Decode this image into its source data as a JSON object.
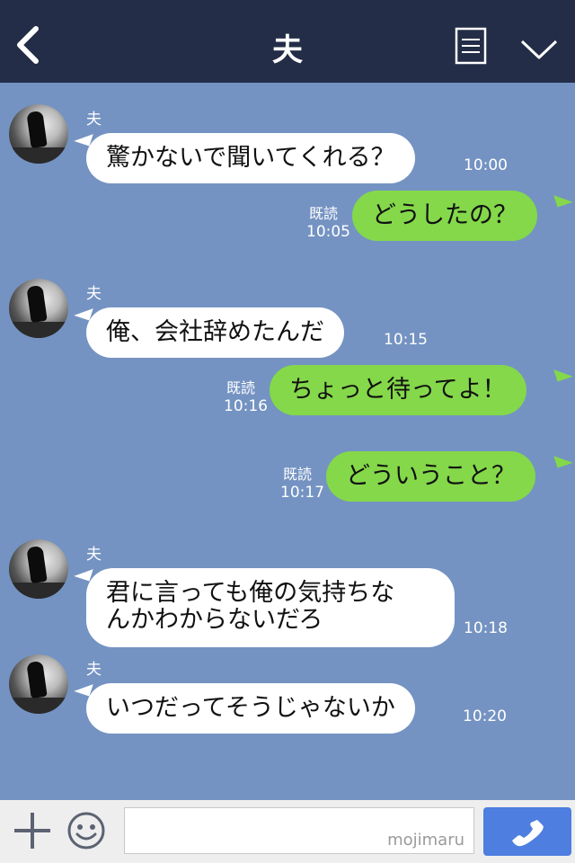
{
  "header": {
    "title": "夫"
  },
  "messages": [
    {
      "type": "in",
      "sender": "夫",
      "text": "驚かないで聞いてくれる？",
      "time": "10:00"
    },
    {
      "type": "out",
      "read": "既読",
      "text": "どうしたの？",
      "time": "10:05"
    },
    {
      "type": "in",
      "sender": "夫",
      "text": "俺、会社辞めたんだ",
      "time": "10:15"
    },
    {
      "type": "out",
      "read": "既読",
      "text": "ちょっと待ってよ！",
      "time": "10:16"
    },
    {
      "type": "out",
      "read": "既読",
      "text": "どういうこと？",
      "time": "10:17"
    },
    {
      "type": "in",
      "sender": "夫",
      "line1": "君に言っても俺の気持ちな",
      "line2": "んかわからないだろ",
      "time": "10:18"
    },
    {
      "type": "in",
      "sender": "夫",
      "text": "いつだってそうじゃないか",
      "time": "10:20"
    }
  ],
  "footer": {
    "watermark": "mojimaru"
  },
  "colors": {
    "header_bg": "#232d47",
    "chat_bg": "#7493c2",
    "outgoing_bubble": "#84d84a",
    "call_button": "#4d7ee0"
  }
}
